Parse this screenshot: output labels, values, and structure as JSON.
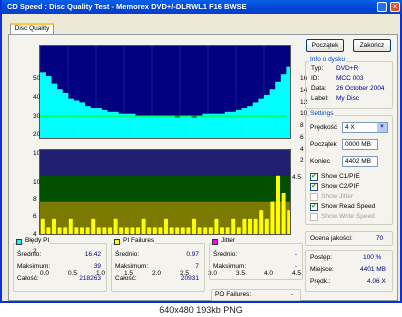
{
  "window": {
    "title": "CD Speed : Disc Quality Test - Memorex DVD+/-DLRWL1 F16 BWSE",
    "min_icon": "minimize-icon",
    "close_icon": "close-icon"
  },
  "tabs": [
    {
      "label": "Disc Quality"
    }
  ],
  "buttons": {
    "start": "Początek",
    "close": "Zakończ"
  },
  "disc_info": {
    "title": "Info o dysku",
    "rows": [
      {
        "label": "Typ:",
        "value": "DVD+R"
      },
      {
        "label": "ID:",
        "value": "MCC 003"
      },
      {
        "label": "Data:",
        "value": "26 October 2004"
      },
      {
        "label": "Label:",
        "value": "My Disc"
      }
    ]
  },
  "settings": {
    "title": "Settings",
    "speed_label": "Prędkość",
    "speed_value": "4 X",
    "start_label": "Początek",
    "start_value": "0000 MB",
    "end_label": "Koniec",
    "end_value": "4402 MB",
    "checkboxes": [
      {
        "label": "Show C1/PIE",
        "checked": true,
        "enabled": true
      },
      {
        "label": "Show C2/PIF",
        "checked": true,
        "enabled": true
      },
      {
        "label": "Show Jitter",
        "checked": false,
        "enabled": false
      },
      {
        "label": "Show Read Speed",
        "checked": true,
        "enabled": true
      },
      {
        "label": "Show Write Speed",
        "checked": false,
        "enabled": false
      }
    ]
  },
  "quality": {
    "label": "Ocena jakości:",
    "value": "70"
  },
  "progress": {
    "rows": [
      {
        "label": "Postęp:",
        "value": "100 %"
      },
      {
        "label": "Miejsce:",
        "value": "4401 MB"
      },
      {
        "label": "Prędk.:",
        "value": "4.06 X"
      }
    ]
  },
  "stats": [
    {
      "title": "Błędy PI",
      "color": "#00ffff",
      "rows": [
        {
          "label": "Średnio:",
          "value": "16.42"
        },
        {
          "label": "Maksimum:",
          "value": "39"
        },
        {
          "label": "Całość:",
          "value": "218263"
        }
      ]
    },
    {
      "title": "PI Failures",
      "color": "#ffff00",
      "rows": [
        {
          "label": "Średnio:",
          "value": "0.97"
        },
        {
          "label": "Maksimum:",
          "value": "7"
        },
        {
          "label": "Całość:",
          "value": "20931"
        }
      ]
    },
    {
      "title": "Jitter",
      "color": "#ff00ff",
      "rows": [
        {
          "label": "Średnio:",
          "value": "-"
        },
        {
          "label": "Maksimum:",
          "value": "-"
        }
      ]
    }
  ],
  "po_failures": {
    "label": "PO Failures:",
    "value": "-"
  },
  "chart_data": [
    {
      "type": "area",
      "title": "PI errors",
      "x_ticks": [
        "0.0",
        "0.5",
        "1.0",
        "1.5",
        "2.0",
        "2.5",
        "3.0",
        "3.5",
        "4.0",
        "4.5"
      ],
      "xlim": [
        0,
        4.5
      ],
      "y_left_ticks": [
        "50",
        "40",
        "30",
        "20",
        "10"
      ],
      "ylim_left": [
        0,
        50
      ],
      "y_right_ticks": [
        "16",
        "14",
        "12",
        "10",
        "8",
        "6",
        "4",
        "2"
      ],
      "ylim_right": [
        0,
        16
      ],
      "series": [
        {
          "name": "Błędy PI",
          "color": "#00ffff",
          "x": [
            0.0,
            0.1,
            0.2,
            0.3,
            0.4,
            0.5,
            0.6,
            0.7,
            0.8,
            0.9,
            1.0,
            1.1,
            1.2,
            1.3,
            1.4,
            1.5,
            1.6,
            1.7,
            1.8,
            1.9,
            2.0,
            2.1,
            2.2,
            2.3,
            2.4,
            2.5,
            2.6,
            2.7,
            2.8,
            2.9,
            3.0,
            3.1,
            3.2,
            3.3,
            3.4,
            3.5,
            3.6,
            3.7,
            3.8,
            3.9,
            4.0,
            4.1,
            4.2,
            4.3,
            4.4
          ],
          "values": [
            36,
            34,
            30,
            27,
            25,
            22,
            21,
            20,
            18,
            17,
            17,
            16,
            15,
            15,
            14,
            14,
            14,
            13,
            13,
            13,
            13,
            13,
            13,
            13,
            12,
            13,
            13,
            12,
            13,
            14,
            14,
            14,
            14,
            15,
            15,
            16,
            17,
            18,
            20,
            22,
            24,
            27,
            31,
            35,
            39
          ]
        },
        {
          "name": "Read Speed",
          "color": "#00ff00",
          "x": [
            0.0,
            4.4
          ],
          "values": [
            4.06,
            4.06
          ]
        }
      ]
    },
    {
      "type": "bar",
      "title": "PI failures",
      "x_ticks": [
        "0.0",
        "0.5",
        "1.0",
        "1.5",
        "2.0",
        "2.5",
        "3.0",
        "3.5",
        "4.0",
        "4.5"
      ],
      "xlim": [
        0,
        4.5
      ],
      "y_left_ticks": [
        "10",
        "8",
        "6",
        "4",
        "2"
      ],
      "ylim_left": [
        0,
        10
      ],
      "series": [
        {
          "name": "PI Failures",
          "color": "#ffff00",
          "x": [
            0.0,
            0.1,
            0.2,
            0.3,
            0.4,
            0.5,
            0.6,
            0.7,
            0.8,
            0.9,
            1.0,
            1.1,
            1.2,
            1.3,
            1.4,
            1.5,
            1.6,
            1.7,
            1.8,
            1.9,
            2.0,
            2.1,
            2.2,
            2.3,
            2.4,
            2.5,
            2.6,
            2.7,
            2.8,
            2.9,
            3.0,
            3.1,
            3.2,
            3.3,
            3.4,
            3.5,
            3.6,
            3.7,
            3.8,
            3.9,
            4.0,
            4.1,
            4.2,
            4.3,
            4.4
          ],
          "values": [
            2,
            1,
            2,
            1,
            1,
            2,
            1,
            1,
            1,
            2,
            1,
            1,
            1,
            2,
            1,
            1,
            1,
            1,
            2,
            1,
            1,
            1,
            2,
            1,
            1,
            1,
            1,
            2,
            1,
            1,
            1,
            2,
            1,
            1,
            2,
            1,
            2,
            2,
            2,
            3,
            2,
            4,
            7,
            5,
            3
          ]
        }
      ]
    }
  ],
  "footer": {
    "caption": "640x480 193kb PNG"
  }
}
